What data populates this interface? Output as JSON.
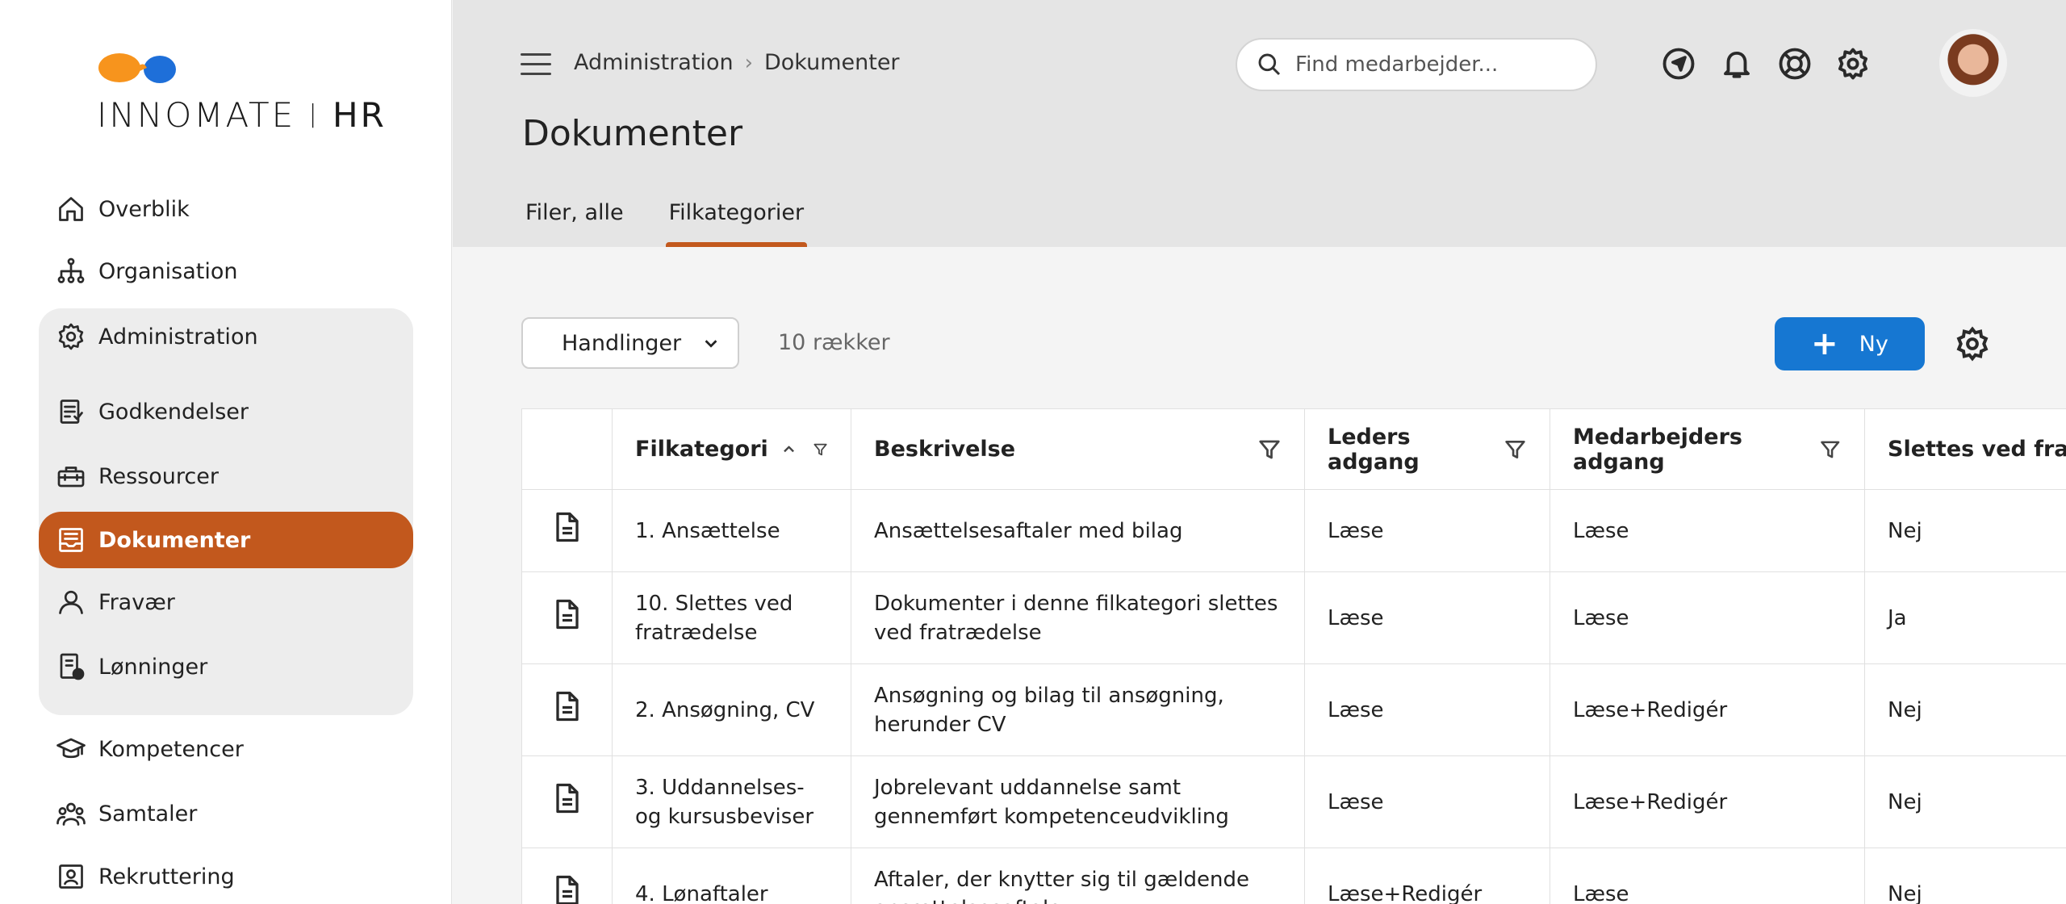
{
  "brand": {
    "name_part1": "INNOMATE",
    "separator": "|",
    "name_part2": "HR",
    "color_primary": "#c2581d",
    "color_orange": "#f7941d",
    "color_blue": "#1e6fd9"
  },
  "sidebar": {
    "items": [
      {
        "label": "Overblik",
        "icon": "home-icon"
      },
      {
        "label": "Organisation",
        "icon": "org-chart-icon"
      },
      {
        "label": "Administration",
        "icon": "gear-icon"
      },
      {
        "label": "Godkendelser",
        "icon": "approval-doc-icon"
      },
      {
        "label": "Ressourcer",
        "icon": "toolbox-icon"
      },
      {
        "label": "Dokumenter",
        "icon": "document-tray-icon"
      },
      {
        "label": "Fravær",
        "icon": "person-icon"
      },
      {
        "label": "Lønninger",
        "icon": "payroll-icon"
      },
      {
        "label": "Kompetencer",
        "icon": "graduation-cap-icon"
      },
      {
        "label": "Samtaler",
        "icon": "people-group-icon"
      },
      {
        "label": "Rekruttering",
        "icon": "recruitment-icon"
      }
    ],
    "active": "Dokumenter"
  },
  "header": {
    "breadcrumb": [
      "Administration",
      "Dokumenter"
    ],
    "title": "Dokumenter",
    "search_placeholder": "Find medarbejder...",
    "tabs": [
      {
        "label": "Filer, alle"
      },
      {
        "label": "Filkategorier"
      }
    ],
    "active_tab": "Filkategorier"
  },
  "toolbar": {
    "actions_label": "Handlinger",
    "row_count": "10 rækker",
    "new_label": "Ny"
  },
  "table": {
    "columns": [
      "Filkategori",
      "Beskrivelse",
      "Leders adgang",
      "Medarbejders adgang",
      "Slettes ved fratræ"
    ],
    "rows": [
      {
        "category": "1. Ansættelse",
        "description": "Ansættelsesaftaler med bilag",
        "manager": "Læse",
        "employee": "Læse",
        "delete": "Nej"
      },
      {
        "category": "10. Slettes ved fratrædelse",
        "description": "Dokumenter i denne filkategori slettes ved fratrædelse",
        "manager": "Læse",
        "employee": "Læse",
        "delete": "Ja"
      },
      {
        "category": "2. Ansøgning, CV",
        "description": "Ansøgning og bilag til ansøgning, herunder CV",
        "manager": "Læse",
        "employee": "Læse+Redigér",
        "delete": "Nej"
      },
      {
        "category": "3. Uddannelses- og kursusbeviser",
        "description": "Jobrelevant uddannelse samt gennemført kompetenceudvikling",
        "manager": "Læse",
        "employee": "Læse+Redigér",
        "delete": "Nej"
      },
      {
        "category": "4. Lønaftaler",
        "description": "Aftaler, der knytter sig til gældende ansættelsesaftale",
        "manager": "Læse+Redigér",
        "employee": "Læse",
        "delete": "Nej"
      }
    ]
  }
}
